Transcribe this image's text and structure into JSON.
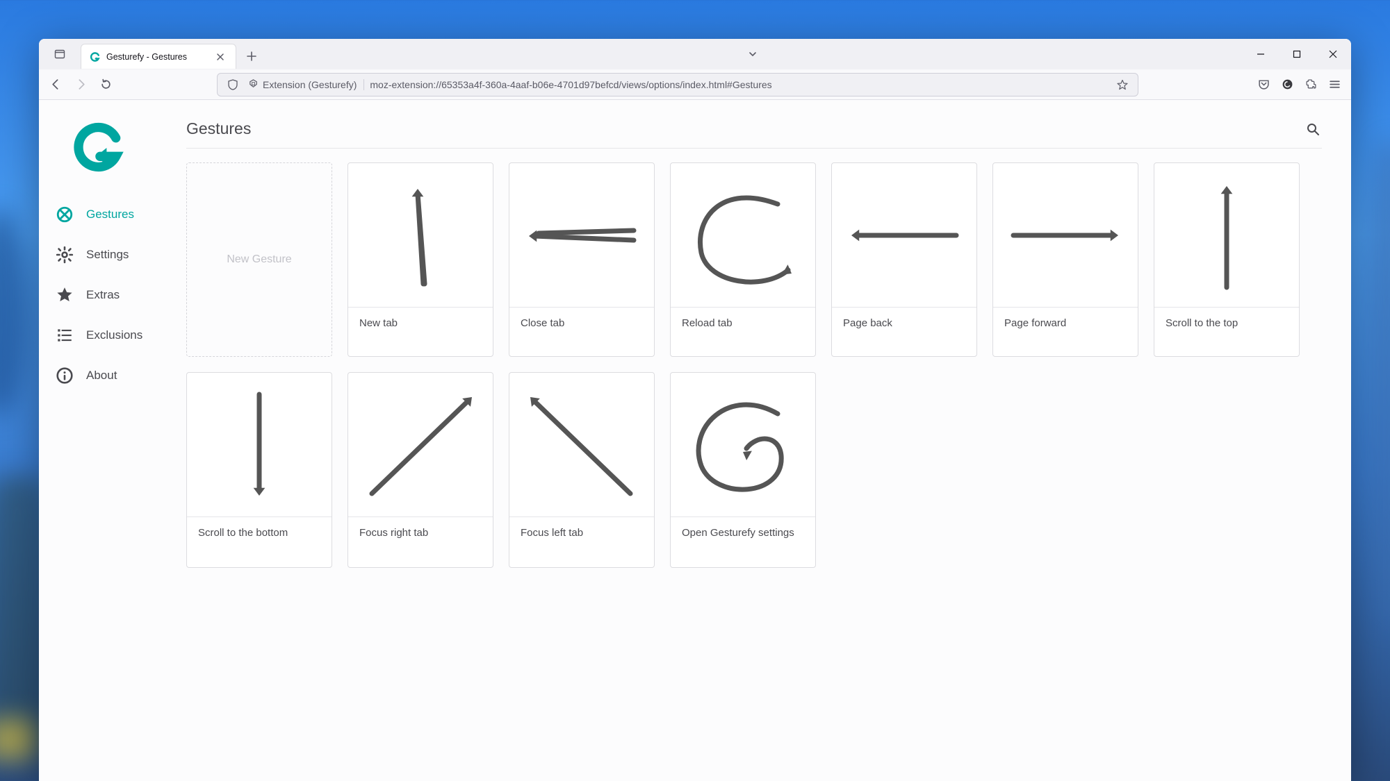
{
  "browser": {
    "tab_title": "Gesturefy - Gestures",
    "url_identity": "Extension (Gesturefy)",
    "url": "moz-extension://65353a4f-360a-4aaf-b06e-4701d97befcd/views/options/index.html#Gestures"
  },
  "page": {
    "title": "Gestures",
    "new_gesture_label": "New Gesture",
    "accent": "#00a6a0"
  },
  "sidebar": {
    "items": [
      {
        "label": "Gestures",
        "icon": "gestures",
        "active": true
      },
      {
        "label": "Settings",
        "icon": "settings",
        "active": false
      },
      {
        "label": "Extras",
        "icon": "extras",
        "active": false
      },
      {
        "label": "Exclusions",
        "icon": "exclusions",
        "active": false
      },
      {
        "label": "About",
        "icon": "about",
        "active": false
      }
    ]
  },
  "gestures": [
    {
      "label": "New tab",
      "shape": "up-narrow"
    },
    {
      "label": "Close tab",
      "shape": "left-double"
    },
    {
      "label": "Reload tab",
      "shape": "c-loop"
    },
    {
      "label": "Page back",
      "shape": "left"
    },
    {
      "label": "Page forward",
      "shape": "right"
    },
    {
      "label": "Scroll to the top",
      "shape": "up"
    },
    {
      "label": "Scroll to the bottom",
      "shape": "down"
    },
    {
      "label": "Focus right tab",
      "shape": "diag-up-right"
    },
    {
      "label": "Focus left tab",
      "shape": "diag-up-left"
    },
    {
      "label": "Open Gesturefy settings",
      "shape": "g-loop"
    }
  ]
}
